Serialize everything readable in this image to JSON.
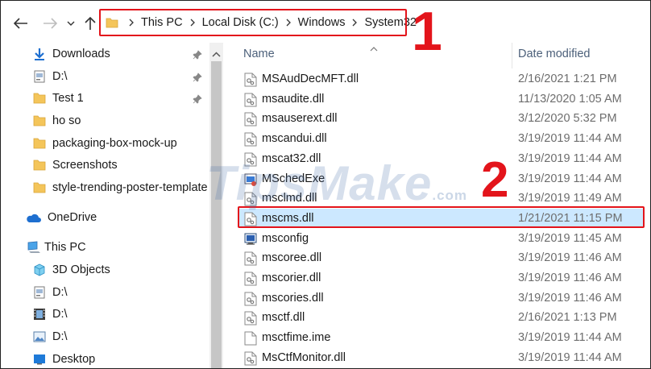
{
  "breadcrumb": [
    "This PC",
    "Local Disk (C:)",
    "Windows",
    "System32"
  ],
  "callouts": {
    "first": "1",
    "second": "2"
  },
  "sidebar": {
    "items": [
      {
        "label": "Downloads",
        "icon": "download-arrow-icon",
        "pinned": true
      },
      {
        "label": "D:\\",
        "icon": "drive-icon",
        "pinned": true
      },
      {
        "label": "Test 1",
        "icon": "folder-icon",
        "pinned": true
      },
      {
        "label": "ho so",
        "icon": "folder-icon",
        "pinned": false
      },
      {
        "label": "packaging-box-mock-up",
        "icon": "folder-icon",
        "pinned": false
      },
      {
        "label": "Screenshots",
        "icon": "folder-icon",
        "pinned": false
      },
      {
        "label": "style-trending-poster-template",
        "icon": "folder-icon",
        "pinned": false
      },
      {
        "label": "OneDrive",
        "icon": "cloud-icon",
        "pinned": false
      },
      {
        "label": "This PC",
        "icon": "computer-icon",
        "pinned": false
      },
      {
        "label": "3D Objects",
        "icon": "cube-icon",
        "pinned": false
      },
      {
        "label": "D:\\",
        "icon": "drive-icon",
        "pinned": false
      },
      {
        "label": "D:\\",
        "icon": "film-icon",
        "pinned": false
      },
      {
        "label": "D:\\",
        "icon": "picture-icon",
        "pinned": false
      },
      {
        "label": "Desktop",
        "icon": "desktop-icon",
        "pinned": false
      }
    ]
  },
  "columns": {
    "name": "Name",
    "date": "Date modified"
  },
  "files": [
    {
      "name": "MSAudDecMFT.dll",
      "date": "2/16/2021 1:21 PM",
      "icon": "dll-file-icon",
      "selected": false
    },
    {
      "name": "msaudite.dll",
      "date": "11/13/2020 1:05 AM",
      "icon": "dll-file-icon",
      "selected": false
    },
    {
      "name": "msauserext.dll",
      "date": "3/12/2020 5:32 PM",
      "icon": "dll-file-icon",
      "selected": false
    },
    {
      "name": "mscandui.dll",
      "date": "3/19/2019 11:44 AM",
      "icon": "dll-file-icon",
      "selected": false
    },
    {
      "name": "mscat32.dll",
      "date": "3/19/2019 11:44 AM",
      "icon": "dll-file-icon",
      "selected": false
    },
    {
      "name": "MSchedExe",
      "date": "3/19/2019 11:44 AM",
      "icon": "app-exe-icon",
      "selected": false
    },
    {
      "name": "msclmd.dll",
      "date": "3/19/2019 11:49 AM",
      "icon": "dll-file-icon",
      "selected": false
    },
    {
      "name": "mscms.dll",
      "date": "1/21/2021 11:15 PM",
      "icon": "dll-file-icon",
      "selected": true
    },
    {
      "name": "msconfig",
      "date": "3/19/2019 11:45 AM",
      "icon": "msconfig-app-icon",
      "selected": false
    },
    {
      "name": "mscoree.dll",
      "date": "3/19/2019 11:46 AM",
      "icon": "dll-file-icon",
      "selected": false
    },
    {
      "name": "mscorier.dll",
      "date": "3/19/2019 11:46 AM",
      "icon": "dll-file-icon",
      "selected": false
    },
    {
      "name": "mscories.dll",
      "date": "3/19/2019 11:46 AM",
      "icon": "dll-file-icon",
      "selected": false
    },
    {
      "name": "msctf.dll",
      "date": "2/16/2021 1:13 PM",
      "icon": "dll-file-icon",
      "selected": false
    },
    {
      "name": "msctfime.ime",
      "date": "3/19/2019 11:44 AM",
      "icon": "ime-file-icon",
      "selected": false
    },
    {
      "name": "MsCtfMonitor.dll",
      "date": "3/19/2019 11:44 AM",
      "icon": "dll-file-icon",
      "selected": false
    }
  ],
  "watermark": {
    "main": "TipsMake",
    "suffix": ".com"
  },
  "colors": {
    "highlight": "#e3141b",
    "selection": "#cce8ff",
    "folder": "#f4c55a",
    "accent": "#0078d7"
  }
}
